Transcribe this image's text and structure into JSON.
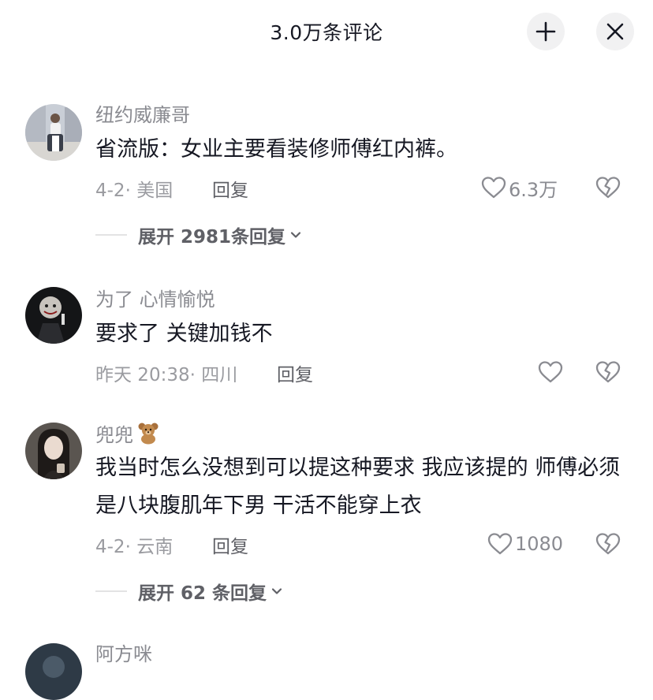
{
  "header": {
    "title": "3.0万条评论",
    "collapse_icon": "collapse-icon",
    "close_icon": "close-icon"
  },
  "comments": [
    {
      "username": "纽约威廉哥",
      "badge": "",
      "text": "省流版：女业主要看装修师傅红内裤。",
      "date": "4-2",
      "location": "美国",
      "meta": "4-2· 美国",
      "reply_label": "回复",
      "like_count": "6.3万",
      "replies_label": "展开 2981条回复"
    },
    {
      "username": "为了  心情愉悦",
      "badge": "",
      "text": "要求了 关键加钱不",
      "date": "昨天 20:38",
      "location": "四川",
      "meta": "昨天 20:38· 四川",
      "reply_label": "回复",
      "like_count": "",
      "replies_label": ""
    },
    {
      "username": "兜兜",
      "badge": "teddy-bear-emoji",
      "text": "我当时怎么没想到可以提这种要求 我应该提的 师傅必须是八块腹肌年下男 干活不能穿上衣",
      "date": "4-2",
      "location": "云南",
      "meta": "4-2· 云南",
      "reply_label": "回复",
      "like_count": "1080",
      "replies_label": "展开 62 条回复"
    },
    {
      "username": "阿方咪",
      "badge": "",
      "text": "",
      "meta": "",
      "reply_label": "",
      "like_count": "",
      "replies_label": ""
    }
  ],
  "colors": {
    "primary_text": "#161823",
    "secondary_text": "#8a8b91",
    "button_bg": "#f1f1f2"
  }
}
